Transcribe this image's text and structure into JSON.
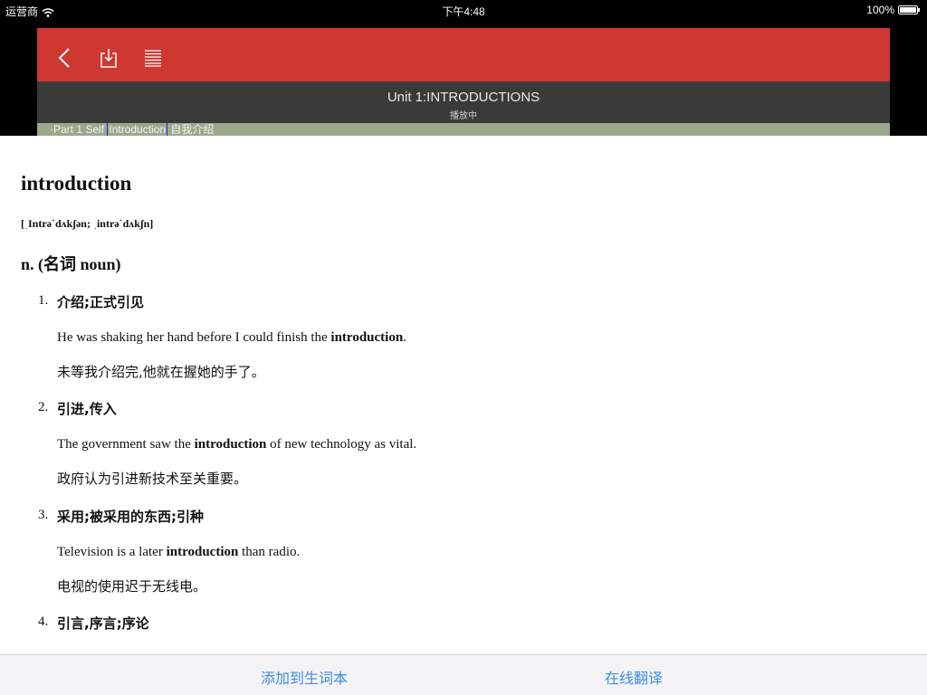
{
  "status_bar": {
    "carrier": "运营商",
    "time": "下午4:48",
    "battery": "100%",
    "battery_level": 1.0
  },
  "player": {
    "icons": [
      "back-icon",
      "download-icon",
      "list-icon"
    ],
    "title": "Unit 1:INTRODUCTIONS",
    "status": "播放中",
    "caption": {
      "before": "·Part 1 Self ",
      "highlight": "Introduction",
      "after": " 自我介绍"
    }
  },
  "entry": {
    "word": "introduction",
    "phonetic": "[ˌIntrəˋdʌkʃən; ˌintrəˋdʌkʃn]",
    "pos": "n. (名词 noun)",
    "senses": [
      {
        "num": "1.",
        "def": "介绍;正式引见",
        "ex_before": "He was shaking her hand before I could finish the ",
        "ex_bold": "introduction",
        "ex_after": ".",
        "ex_zh": "未等我介绍完,他就在握她的手了。"
      },
      {
        "num": "2.",
        "def": "引进,传入",
        "ex_before": "The government saw the ",
        "ex_bold": "introduction",
        "ex_after": " of new technology as vital.",
        "ex_zh": "政府认为引进新技术至关重要。"
      },
      {
        "num": "3.",
        "def": "采用;被采用的东西;引种",
        "ex_before": "Television is a later ",
        "ex_bold": "introduction",
        "ex_after": " than radio.",
        "ex_zh": "电视的使用迟于无线电。"
      },
      {
        "num": "4.",
        "def": "引言,序言;序论"
      }
    ]
  },
  "bottom_bar": {
    "add_label": "添加到生词本",
    "translate_label": "在线翻译"
  },
  "colors": {
    "toolbar_red": "#cf3731",
    "title_bar": "#3a3a3a",
    "caption_bar": "#9aa98a",
    "highlight_border": "#1f2fd8",
    "action_blue": "#3d8ee0"
  }
}
